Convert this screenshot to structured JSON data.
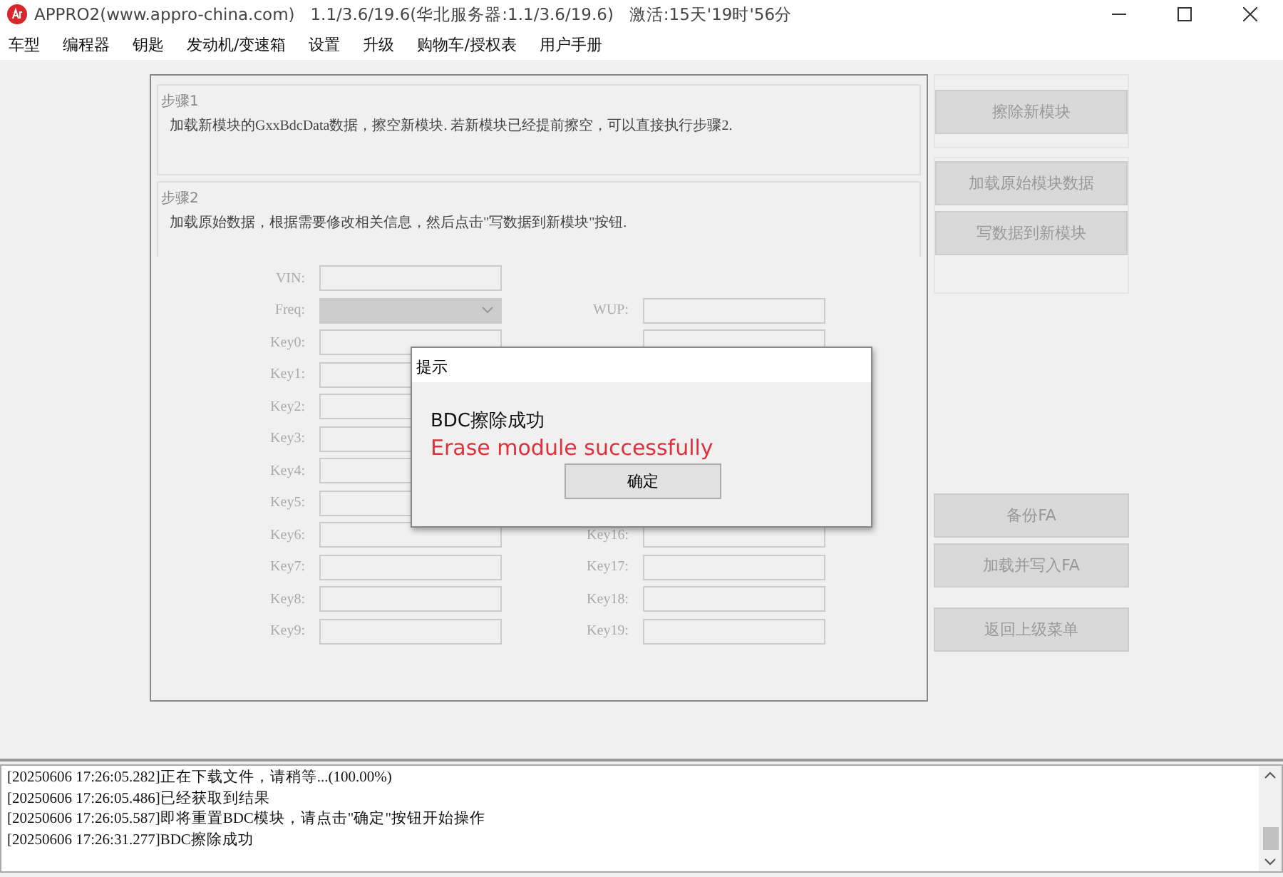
{
  "window": {
    "title": "APPRO2(www.appro-china.com)   1.1/3.6/19.6(华北服务器:1.1/3.6/19.6)   激活:15天'19时'56分"
  },
  "menu": [
    "车型",
    "编程器",
    "钥匙",
    "发动机/变速箱",
    "设置",
    "升级",
    "购物车/授权表",
    "用户手册"
  ],
  "steps": [
    {
      "title": "步骤1",
      "text": "加载新模块的GxxBdcData数据，擦空新模块. 若新模块已经提前擦空，可以直接执行步骤2."
    },
    {
      "title": "步骤2",
      "text": "加载原始数据，根据需要修改相关信息，然后点击\"写数据到新模块\"按钮."
    }
  ],
  "form": {
    "disabled": true,
    "rows": [
      {
        "kind": "single",
        "left": "VIN:"
      },
      {
        "kind": "select",
        "left": "Freq:",
        "right": "WUP:"
      },
      {
        "kind": "pair",
        "left": "Key0:"
      },
      {
        "kind": "pair",
        "left": "Key1:"
      },
      {
        "kind": "pair",
        "left": "Key2:"
      },
      {
        "kind": "pair",
        "left": "Key3:"
      },
      {
        "kind": "pair",
        "left": "Key4:"
      },
      {
        "kind": "pair",
        "left": "Key5:"
      },
      {
        "kind": "pair",
        "left": "Key6:",
        "right": "Key16:"
      },
      {
        "kind": "pair",
        "left": "Key7:",
        "right": "Key17:"
      },
      {
        "kind": "pair",
        "left": "Key8:",
        "right": "Key18:"
      },
      {
        "kind": "pair",
        "left": "Key9:",
        "right": "Key19:"
      }
    ]
  },
  "side_groups": [
    [
      {
        "label": "擦除新模块",
        "disabled": true
      }
    ],
    [
      {
        "label": "加载原始模块数据",
        "disabled": true
      },
      {
        "label": "写数据到新模块",
        "disabled": true
      }
    ],
    [
      {
        "label": "备份FA",
        "disabled": true
      },
      {
        "label": "加载并写入FA",
        "disabled": true
      }
    ],
    [
      {
        "label": "返回上级菜单",
        "disabled": true
      }
    ]
  ],
  "dialog": {
    "title": "提示",
    "message": "BDC擦除成功",
    "note": "Erase module successfully",
    "button": "确定"
  },
  "log": [
    "[20250606 17:26:05.282]正在下载文件，请稍等...(100.00%)",
    "[20250606 17:26:05.486]已经获取到结果",
    "[20250606 17:26:05.587]即将重置BDC模块，请点击\"确定\"按钮开始操作",
    "[20250606 17:26:31.277]BDC擦除成功"
  ]
}
